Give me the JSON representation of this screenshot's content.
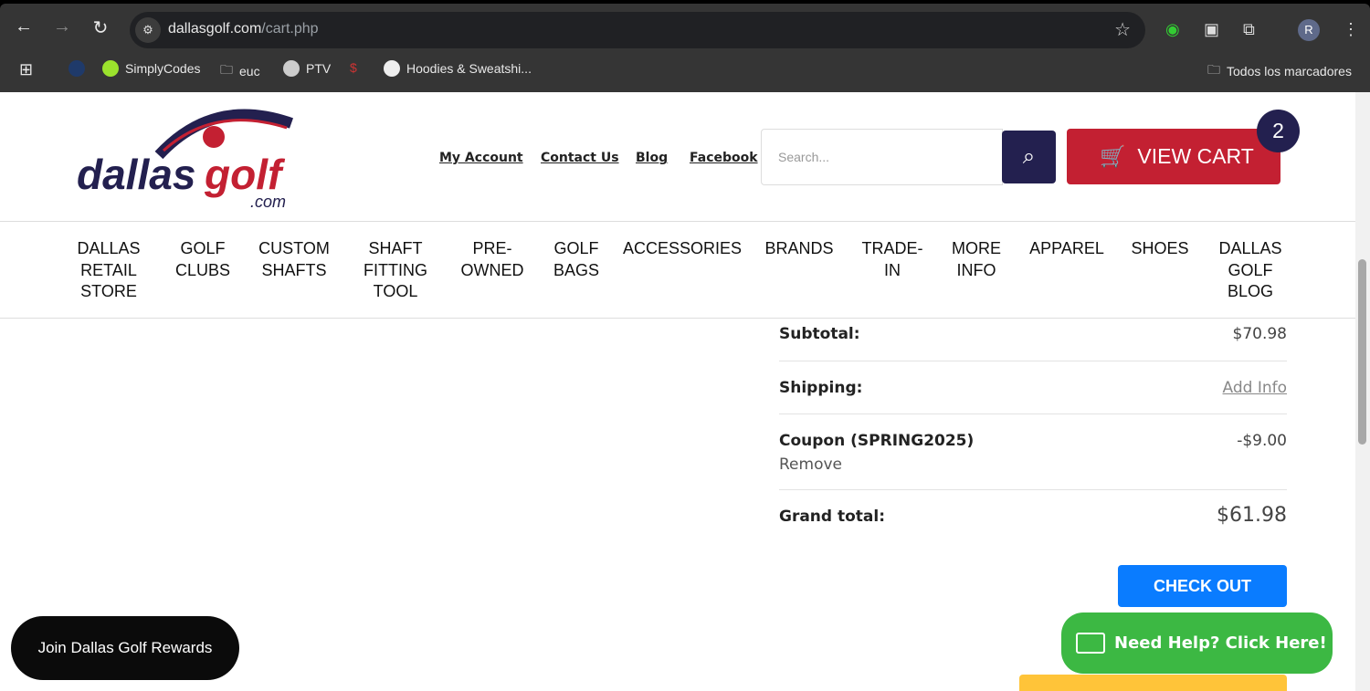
{
  "browser": {
    "url_domain": "dallasgolf.com",
    "url_path": "/cart.php",
    "profile_initial": "R",
    "bookmarks": [
      "SimplyCodes",
      "euc",
      "PTV",
      "Hoodies & Sweatshi..."
    ],
    "all_bookmarks": "Todos los marcadores"
  },
  "header": {
    "links": [
      "My Account",
      "Contact Us",
      "Blog",
      "Facebook"
    ],
    "search_placeholder": "Search...",
    "view_cart": "VIEW CART",
    "cart_count": "2",
    "logo_text": "dallasgolf.com"
  },
  "menu": [
    "DALLAS\nRETAIL\nSTORE",
    "GOLF\nCLUBS",
    "CUSTOM\nSHAFTS",
    "SHAFT\nFITTING\nTOOL",
    "PRE-\nOWNED",
    "GOLF\nBAGS",
    "ACCESSORIES",
    "BRANDS",
    "TRADE-\nIN",
    "MORE\nINFO",
    "APPAREL",
    "SHOES",
    "DALLAS\nGOLF\nBLOG"
  ],
  "summary": {
    "subtotal_label": "Subtotal:",
    "subtotal": "$70.98",
    "shipping_label": "Shipping:",
    "shipping": "Add Info",
    "coupon_label": "Coupon (SPRING2025)",
    "coupon": "-$9.00",
    "remove": "Remove",
    "grand_label": "Grand total:",
    "grand": "$61.98"
  },
  "checkout": "CHECK OUT",
  "help": "Need Help? Click Here!",
  "rewards": "Join Dallas Golf Rewards"
}
